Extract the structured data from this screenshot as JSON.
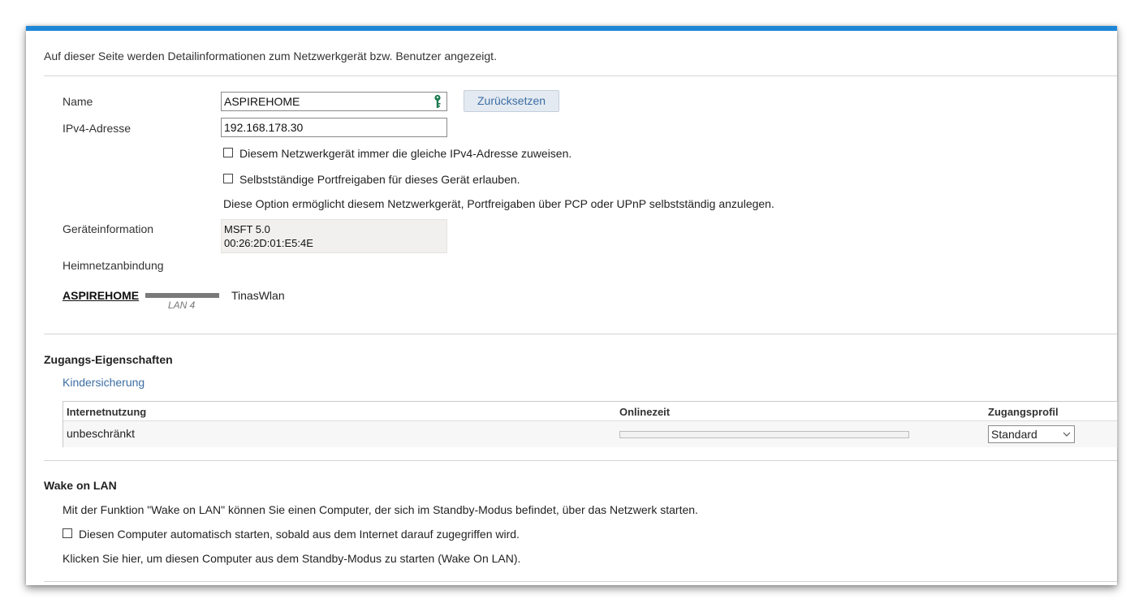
{
  "intro": "Auf dieser Seite werden Detailinformationen zum Netzwerkgerät bzw. Benutzer angezeigt.",
  "form": {
    "name_label": "Name",
    "name_value": "ASPIREHOME",
    "reset_label": "Zurücksetzen",
    "ipv4_label": "IPv4-Adresse",
    "ipv4_value": "192.168.178.30",
    "same_ip_label": "Diesem Netzwerkgerät immer die gleiche IPv4-Adresse zuweisen.",
    "same_ip_checked": false,
    "portfw_label": "Selbstständige Portfreigaben für dieses Gerät erlauben.",
    "portfw_checked": false,
    "portfw_hint": "Diese Option ermöglicht diesem Netzwerkgerät, Portfreigaben über PCP oder UPnP selbstständig anzulegen.",
    "deviceinfo_label": "Geräteinformation",
    "deviceinfo_line1": "MSFT 5.0",
    "deviceinfo_line2": "00:26:2D:01:E5:4E",
    "homenet_label": "Heimnetzanbindung",
    "homenet_device": "ASPIREHOME",
    "homenet_port": "LAN 4",
    "homenet_peer": "TinasWlan"
  },
  "access": {
    "title": "Zugangs-Eigenschaften",
    "parental_link": "Kindersicherung",
    "col_usage": "Internetnutzung",
    "col_online": "Onlinezeit",
    "col_profile": "Zugangsprofil",
    "usage_value": "unbeschränkt",
    "online_progress": 0,
    "profile_value": "Standard"
  },
  "wol": {
    "title": "Wake on LAN",
    "desc": "Mit der Funktion \"Wake on LAN\" können Sie einen Computer, der sich im Standby-Modus befindet, über das Netzwerk starten.",
    "auto_label": "Diesen Computer automatisch starten, sobald aus dem Internet darauf zugegriffen wird.",
    "auto_checked": false,
    "manual_text": "Klicken Sie hier, um diesen Computer aus dem Standby-Modus zu starten (Wake On LAN)."
  },
  "colors": {
    "accent": "#1e86d6",
    "link": "#3b6ea5",
    "key_icon": "#1a7a4e"
  }
}
